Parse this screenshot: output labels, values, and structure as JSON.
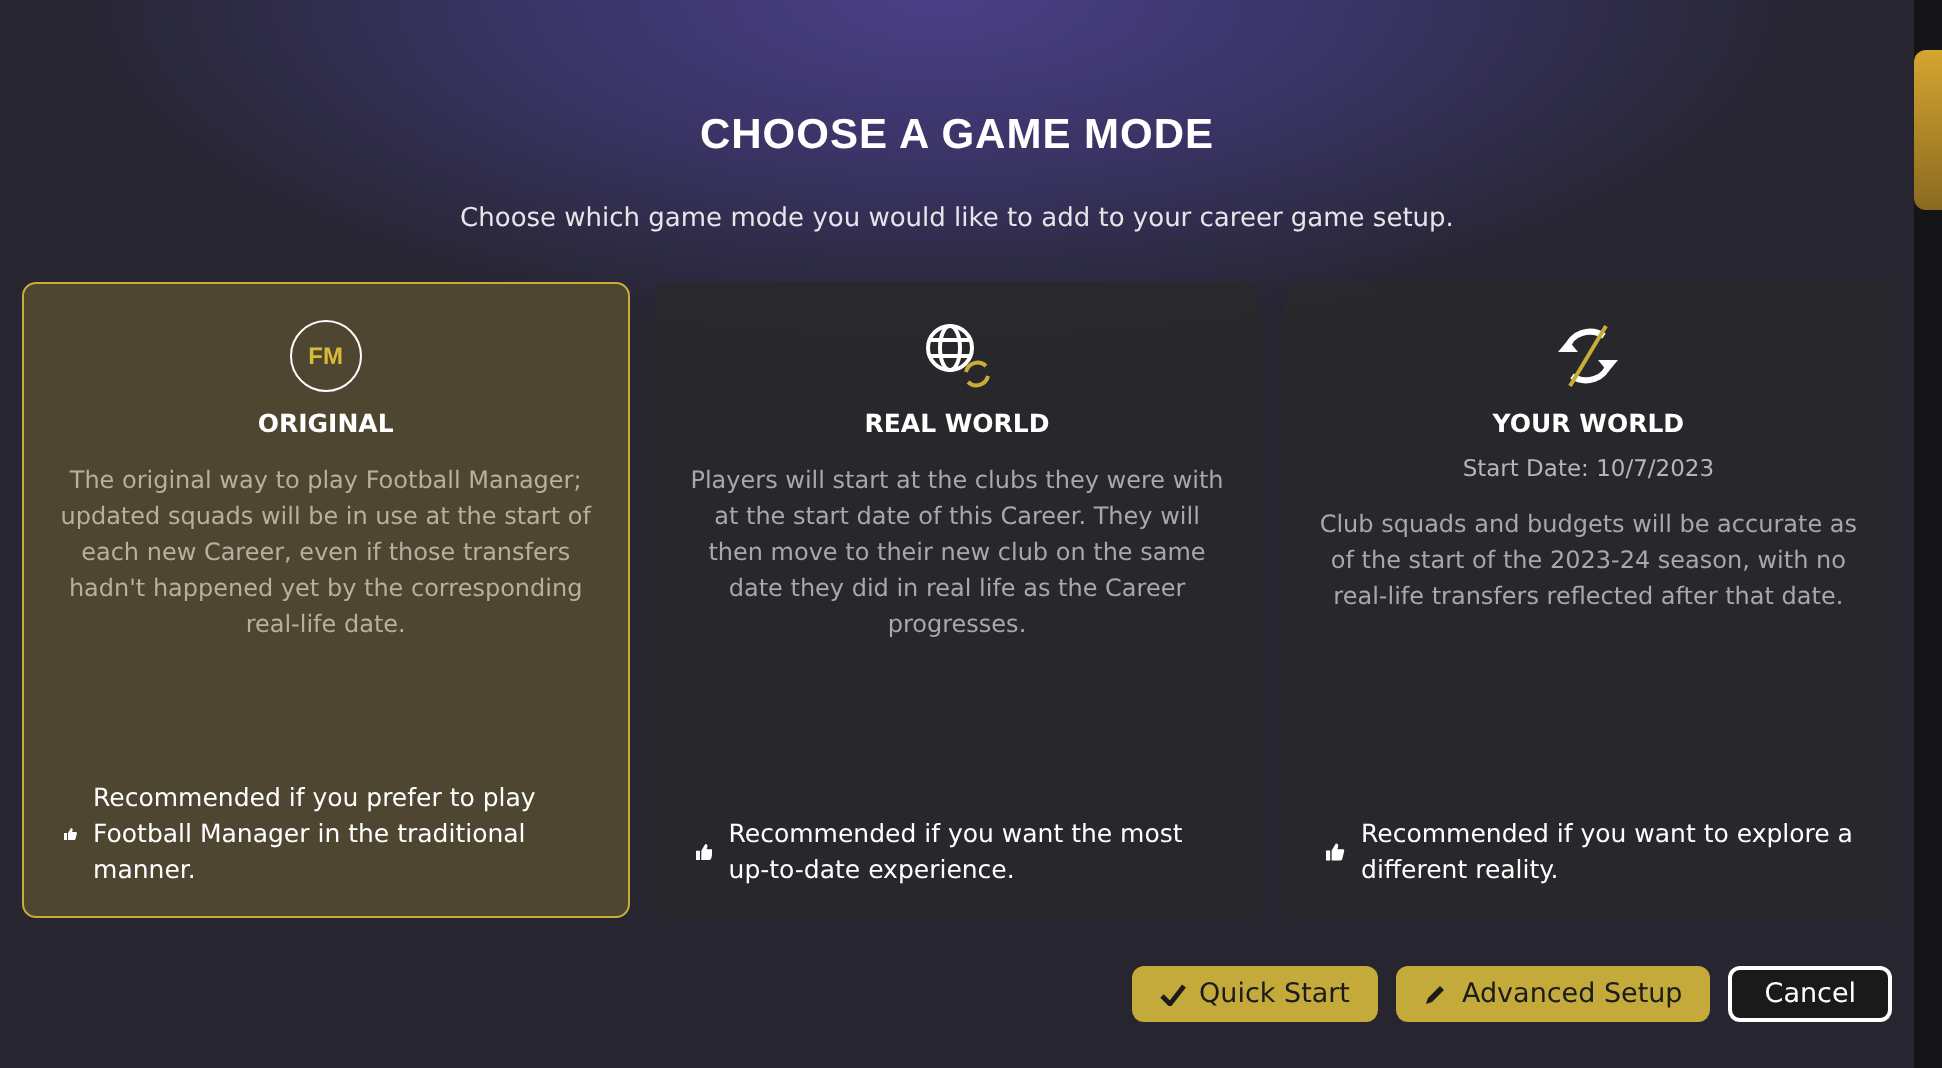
{
  "dialog": {
    "title": "CHOOSE A GAME MODE",
    "subtitle": "Choose which game mode you would like to add to your career game setup."
  },
  "modes": [
    {
      "kind": "logo",
      "logo_text": "FM",
      "name": "ORIGINAL",
      "selected": true,
      "description": "The original way to play Football Manager; updated squads will be in use at the start of each new Career, even if those transfers hadn't happened yet by the corresponding real-life date.",
      "recommendation": "Recommended if you prefer to play Football Manager in the traditional manner."
    },
    {
      "kind": "globe",
      "name": "REAL WORLD",
      "selected": false,
      "description": "Players will start at the clubs they were with at the start date of this Career. They will then move to their new club on the same date they did in real life as the Career progresses.",
      "recommendation": "Recommended if you want the most up-to-date experience."
    },
    {
      "kind": "split",
      "name": "YOUR WORLD",
      "selected": false,
      "start_date": "Start Date: 10/7/2023",
      "description": "Club squads and budgets will be accurate as of the start of the 2023-24 season, with no real-life transfers reflected after that date.",
      "recommendation": "Recommended if you want to explore a different reality."
    }
  ],
  "buttons": [
    {
      "kind": "check",
      "label": "Quick Start"
    },
    {
      "kind": "pencil",
      "label": "Advanced Setup"
    },
    {
      "kind": "outline",
      "label": "Cancel"
    }
  ]
}
